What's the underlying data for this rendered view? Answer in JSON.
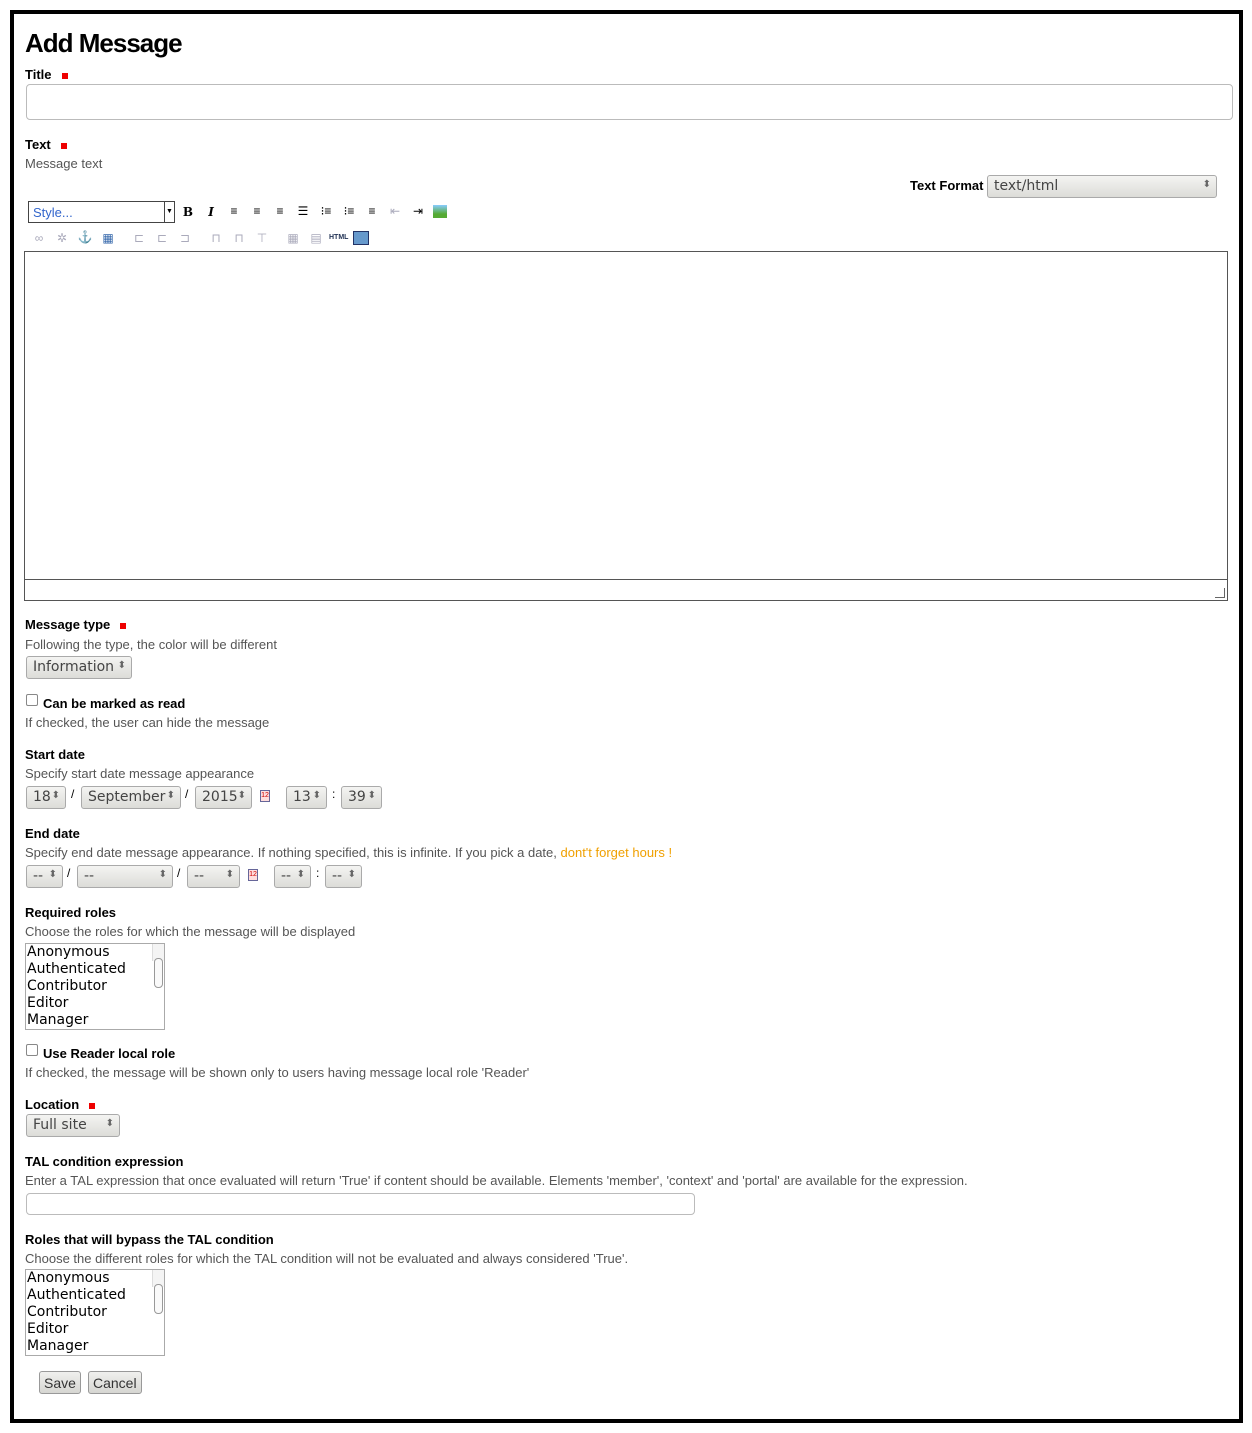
{
  "page_title": "Add Message",
  "title_field": {
    "label": "Title",
    "value": ""
  },
  "text_field": {
    "label": "Text",
    "help": "Message text",
    "text_format_label": "Text Format",
    "text_format_value": "text/html",
    "style_placeholder": "Style...",
    "html_label": "HTML",
    "toolbar_row1": [
      "bold-icon",
      "italic-icon",
      "align-left-icon",
      "align-center-icon",
      "align-right-icon",
      "justify-icon",
      "bullet-list-icon",
      "numbered-list-icon",
      "definition-list-icon",
      "outdent-icon",
      "indent-icon",
      "insert-image-icon"
    ],
    "toolbar_row2": [
      "link-icon",
      "unlink-icon",
      "anchor-icon",
      "insert-table-icon",
      "row-before-icon",
      "row-after-icon",
      "delete-row-icon",
      "col-before-icon",
      "col-after-icon",
      "delete-col-icon",
      "table-props-icon",
      "cell-props-icon",
      "html-source-icon",
      "fullscreen-icon"
    ]
  },
  "message_type": {
    "label": "Message type",
    "help": "Following the type, the color will be different",
    "value": "Information"
  },
  "can_be_read": {
    "label": "Can be marked as read",
    "help": "If checked, the user can hide the message",
    "checked": false
  },
  "start_date": {
    "label": "Start date",
    "help": "Specify start date message appearance",
    "day": "18",
    "month": "September",
    "year": "2015",
    "hour": "13",
    "minute": "39"
  },
  "end_date": {
    "label": "End date",
    "help": "Specify end date message appearance. If nothing specified, this is infinite. If you pick a date, ",
    "help_warn": "dont't forget hours !",
    "day": "--",
    "month": "--",
    "year": "--",
    "hour": "--",
    "minute": "--"
  },
  "required_roles": {
    "label": "Required roles",
    "help": "Choose the roles for which the message will be displayed",
    "options": [
      "Anonymous",
      "Authenticated",
      "Contributor",
      "Editor",
      "Manager"
    ]
  },
  "use_reader": {
    "label": "Use Reader local role",
    "help": "If checked, the message will be shown only to users having message local role 'Reader'",
    "checked": false
  },
  "location": {
    "label": "Location",
    "value": "Full site"
  },
  "tal": {
    "label": "TAL condition expression",
    "help": "Enter a TAL expression that once evaluated will return 'True' if content should be available. Elements 'member', 'context' and 'portal' are available for the expression.",
    "value": ""
  },
  "bypass": {
    "label": "Roles that will bypass the TAL condition",
    "help": "Choose the different roles for which the TAL condition will not be evaluated and always considered 'True'.",
    "options": [
      "Anonymous",
      "Authenticated",
      "Contributor",
      "Editor",
      "Manager"
    ]
  },
  "buttons": {
    "save": "Save",
    "cancel": "Cancel"
  },
  "colors": {
    "required": "#ee0000",
    "warning": "#f0a000"
  }
}
